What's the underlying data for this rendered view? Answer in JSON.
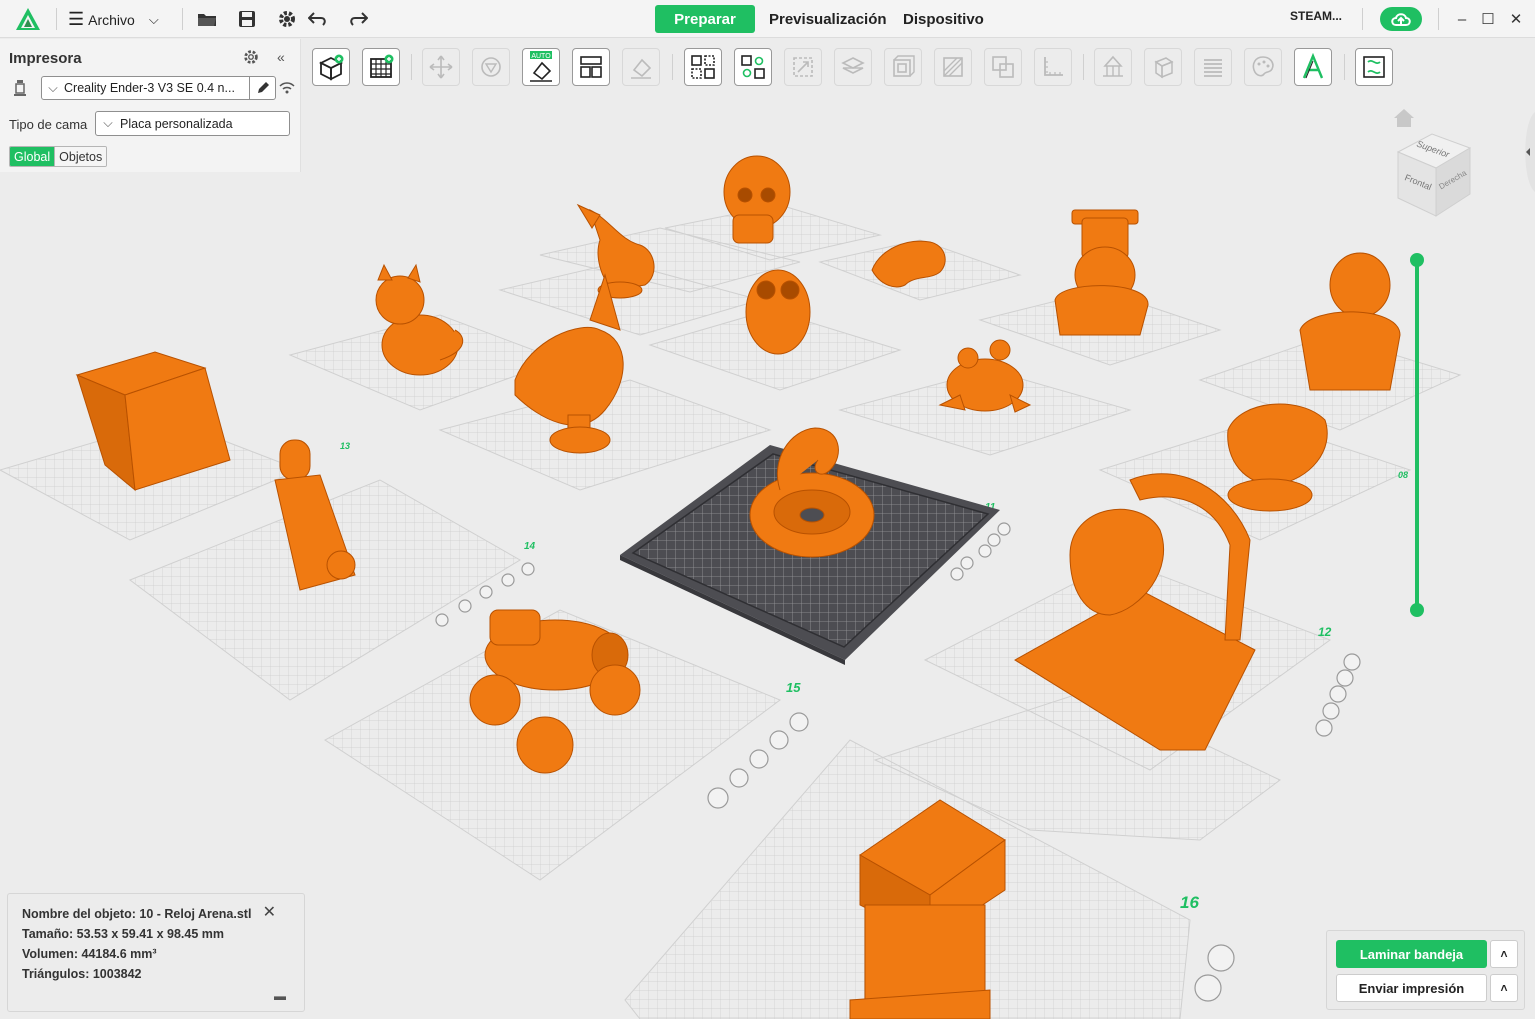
{
  "titlebar": {
    "menu_label": "Archivo",
    "tabs": [
      "Preparar",
      "Previsualización",
      "Dispositivo"
    ],
    "account": "STEAM..."
  },
  "printer_panel": {
    "title": "Impresora",
    "printer": "Creality Ender-3 V3 SE 0.4 n...",
    "bed_type_label": "Tipo de cama",
    "bed_type": "Placa personalizada",
    "toggle_global": "Global",
    "toggle_objects": "Objetos"
  },
  "object_info": {
    "name": "Nombre del objeto: 10 - Reloj Arena.stl",
    "size": "Tamaño: 53.53 x 59.41 x 98.45 mm",
    "volume": "Volumen: 44184.6 mm³",
    "triangles": "Triángulos: 1003842"
  },
  "actions": {
    "slice": "Laminar bandeja",
    "send": "Enviar impresión"
  },
  "view_cube": {
    "top": "Superior",
    "front": "Frontal",
    "right": "Derecha"
  },
  "plates": [
    "08",
    "11",
    "12",
    "13",
    "14",
    "15",
    "16"
  ],
  "colors": {
    "accent": "#1fbf62",
    "model": "#f07a12",
    "plate_active": "#4d4d52"
  }
}
